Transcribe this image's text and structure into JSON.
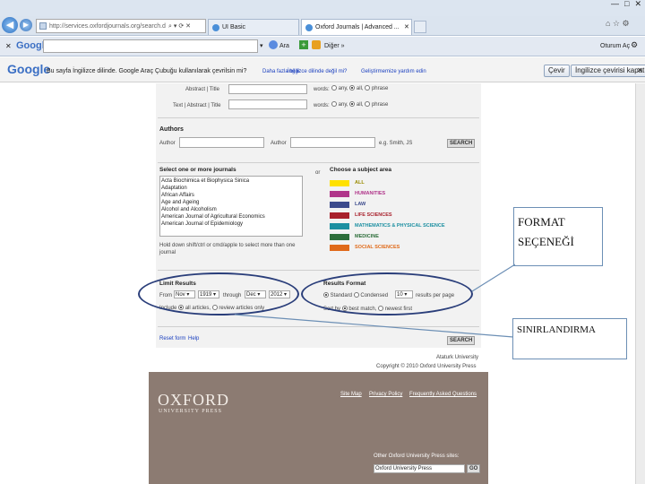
{
  "window": {
    "controls": [
      "—",
      "□",
      "✕"
    ]
  },
  "tabs": {
    "address": "http://services.oxfordjournals.org/search.do",
    "tab1": "UI Basic",
    "tab2": "Oxford Journals | Advanced ..."
  },
  "google_bar": {
    "brand": "Google",
    "search_placeholder": "",
    "sign_in": "Oturum Aç",
    "more": "Diğer »",
    "ara": "Ara"
  },
  "translate_bar": {
    "brand": "Google",
    "message": "Bu sayfa İngilizce dilinde. Google Araç Çubuğu kullanılarak çevrilsin mi?",
    "more_info": "Daha fazla bilgi",
    "wrong_lang": "İngilizce dilinde değil mi?",
    "help": "Geliştirmemize yardım edin",
    "translate_btn": "Çevir",
    "always_btn": "İngilizce çevirisi kapat"
  },
  "form": {
    "abstract_label": "Abstract | Title",
    "text_label": "Text | Abstract | Title",
    "words_label": "words:",
    "any": "any,",
    "all": "all,",
    "phrase": "phrase",
    "authors_heading": "Authors",
    "author_label": "Author",
    "author_label2": "Author",
    "author_hint": "e.g. Smith, JS",
    "search_btn": "SEARCH",
    "journals_heading": "Select one or more journals",
    "or_label": "or",
    "subject_heading": "Choose a subject area",
    "journals": [
      "Acta Biochimica et Biophysica Sinica",
      "Adaptation",
      "African Affairs",
      "Age and Ageing",
      "Alcohol and Alcoholism",
      "American Journal of Agricultural Economics",
      "American Journal of Epidemiology"
    ],
    "subjects": [
      {
        "label": "ALL",
        "color": "#ffe100"
      },
      {
        "label": "HUMANITIES",
        "color": "#b0358a"
      },
      {
        "label": "LAW",
        "color": "#3b4a8c"
      },
      {
        "label": "LIFE SCIENCES",
        "color": "#a8212c"
      },
      {
        "label": "MATHEMATICS & PHYSICAL SCIENCE",
        "color": "#1c8fa1"
      },
      {
        "label": "MEDICINE",
        "color": "#2d6e3a"
      },
      {
        "label": "SOCIAL SCIENCES",
        "color": "#e06a1a"
      }
    ],
    "hold_hint": "Hold down shift/ctrl or cmd/apple to select more than one journal",
    "limit_heading": "Limit Results",
    "from_label": "From",
    "from_month": "Nov",
    "from_year": "1919",
    "through_label": "through",
    "to_month": "Dec",
    "to_year": "2012",
    "include_label": "Include",
    "all_articles": "all articles,",
    "review_only": "review articles only",
    "format_heading": "Results Format",
    "standard": "Standard",
    "condensed": "Condensed",
    "count": "10",
    "results_per_page": "results per page",
    "sort_label": "Sort by",
    "best_match": "best match,",
    "newest_first": "newest first",
    "reset": "Reset form",
    "help": "Help"
  },
  "footer": {
    "university": "Ataturk University",
    "copyright": "Copyright © 2010 Oxford University Press",
    "logo1": "OXFORD",
    "logo2": "UNIVERSITY PRESS",
    "links": [
      "Site Map",
      "Privacy Policy",
      "Frequently Asked Questions"
    ],
    "other_sites": "Other Oxford University Press sites:",
    "site_select": "Oxford University Press",
    "go": "GO"
  },
  "annotations": {
    "format": "FORMAT SEÇENEĞİ",
    "limit": "SINIRLANDIRMA"
  }
}
